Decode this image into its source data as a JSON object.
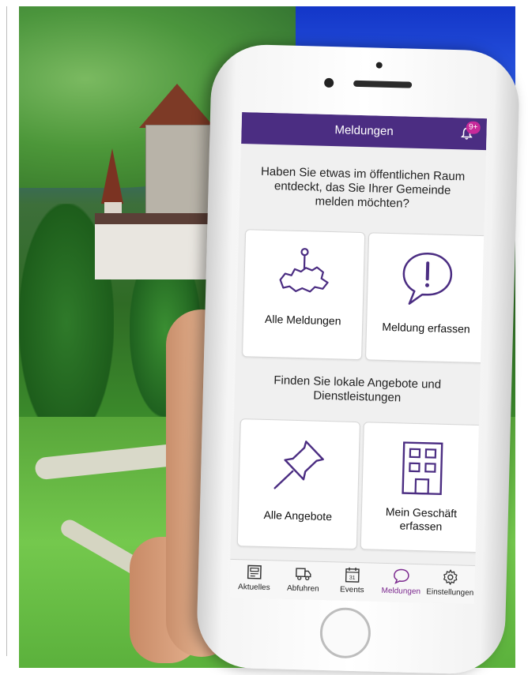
{
  "app": {
    "title": "Meldungen",
    "notification_badge": "9+",
    "accent_color": "#4b2d82",
    "active_color": "#7c2a8f"
  },
  "content": {
    "question_1": "Haben Sie etwas im öffentlichen Raum entdeckt, das Sie Ihrer Gemeinde melden möchten?",
    "question_2": "Finden Sie lokale Angebote und Dienstleistungen",
    "cards": [
      {
        "label": "Alle Meldungen",
        "icon": "map-pin-switzerland-icon"
      },
      {
        "label": "Meldung erfassen",
        "icon": "speech-bubble-exclamation-icon"
      },
      {
        "label": "Alle Angebote",
        "icon": "pushpin-icon"
      },
      {
        "label": "Mein Geschäft erfassen",
        "icon": "building-icon"
      }
    ]
  },
  "tabbar": {
    "items": [
      {
        "label": "Aktuelles",
        "icon": "news-icon"
      },
      {
        "label": "Abfuhren",
        "icon": "truck-icon"
      },
      {
        "label": "Events",
        "icon": "calendar-icon",
        "calendar_day": "31"
      },
      {
        "label": "Meldungen",
        "icon": "speech-bubble-icon",
        "active": true
      },
      {
        "label": "Einstellungen",
        "icon": "gear-icon"
      }
    ]
  }
}
